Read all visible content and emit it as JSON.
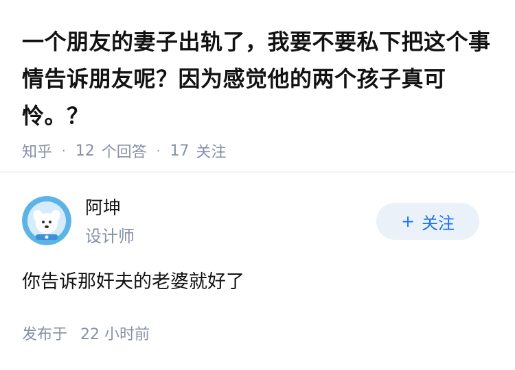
{
  "question": {
    "title": "一个朋友的妻子出轨了，我要不要私下把这个事情告诉朋友呢？因为感觉他的两个孩子真可怜。？",
    "source": "知乎",
    "answers_count": "12",
    "answers_label": "个回答",
    "followers_count": "17",
    "followers_label": "关注"
  },
  "author": {
    "name": "阿坤",
    "title": "设计师",
    "avatar_icon": "dog-astronaut-avatar",
    "follow_label": "关注",
    "follow_icon": "plus-icon"
  },
  "answer": {
    "text": "你告诉那奸夫的老婆就好了"
  },
  "footer": {
    "published_label": "发布于",
    "published_time": "22 小时前"
  },
  "colors": {
    "primary_text": "#121212",
    "secondary_text": "#8590a6",
    "accent": "#1772f6",
    "button_bg": "#ebf1f8",
    "divider": "#f2f3f5"
  }
}
